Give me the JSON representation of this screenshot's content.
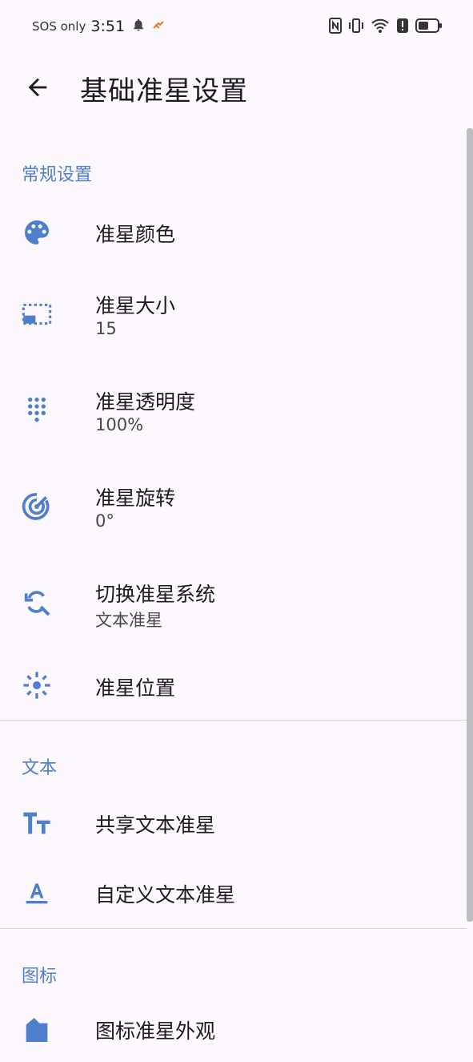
{
  "status_bar": {
    "sos": "SOS only",
    "time": "3:51"
  },
  "app_bar": {
    "title": "基础准星设置"
  },
  "sections": {
    "general": "常规设置",
    "text": "文本",
    "icon": "图标"
  },
  "items": {
    "color": {
      "label": "准星颜色"
    },
    "size": {
      "label": "准星大小",
      "value": "15"
    },
    "opacity": {
      "label": "准星透明度",
      "value": "100%"
    },
    "rotation": {
      "label": "准星旋转",
      "value": "0°"
    },
    "system": {
      "label": "切换准星系统",
      "value": "文本准星"
    },
    "position": {
      "label": "准星位置"
    },
    "shared_text": {
      "label": "共享文本准星"
    },
    "custom_text": {
      "label": "自定义文本准星"
    },
    "icon_appearance": {
      "label": "图标准星外观"
    }
  },
  "colors": {
    "accent": "#4f7fcc",
    "background": "#fdf8fd"
  }
}
